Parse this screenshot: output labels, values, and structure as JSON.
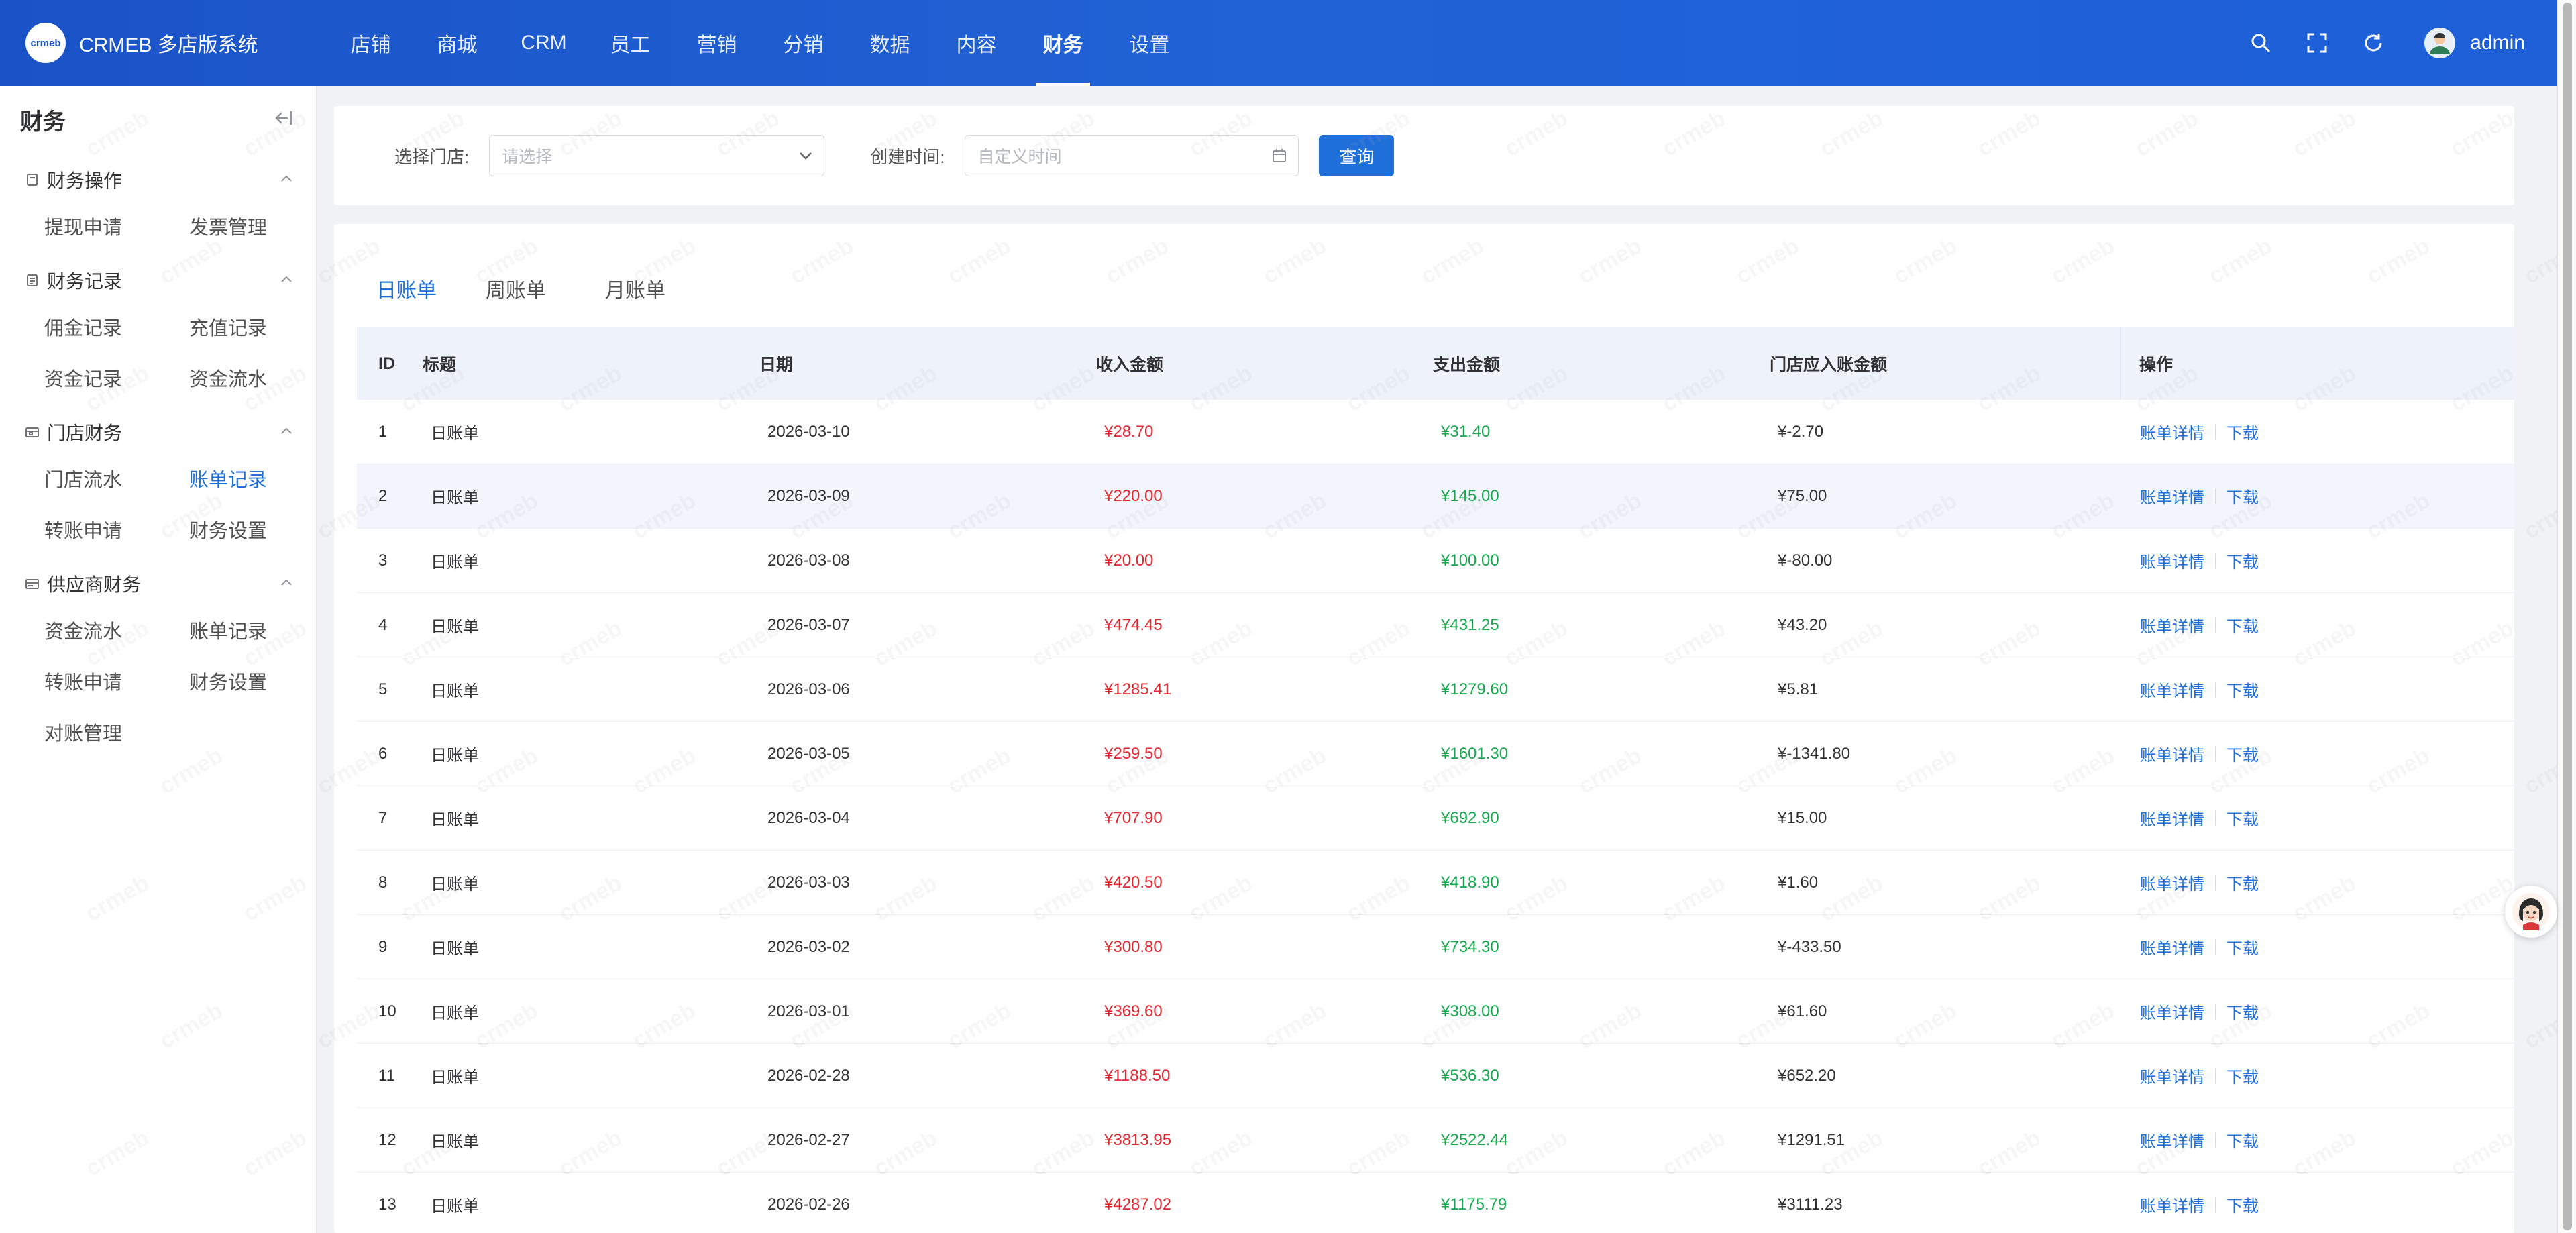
{
  "app": {
    "logo_mark": "crmeb",
    "title": "CRMEB 多店版系统",
    "user_name": "admin"
  },
  "nav": [
    {
      "label": "店铺",
      "active": false
    },
    {
      "label": "商城",
      "active": false
    },
    {
      "label": "CRM",
      "active": false
    },
    {
      "label": "员工",
      "active": false
    },
    {
      "label": "营销",
      "active": false
    },
    {
      "label": "分销",
      "active": false
    },
    {
      "label": "数据",
      "active": false
    },
    {
      "label": "内容",
      "active": false
    },
    {
      "label": "财务",
      "active": true
    },
    {
      "label": "设置",
      "active": false
    }
  ],
  "top_icons": [
    "search-icon",
    "fullscreen-icon",
    "refresh-icon"
  ],
  "sidebar": {
    "title": "财务",
    "groups": [
      {
        "label": "财务操作",
        "icon": "document-icon",
        "items": [
          "提现申请",
          "发票管理"
        ]
      },
      {
        "label": "财务记录",
        "icon": "list-icon",
        "items": [
          "佣金记录",
          "充值记录",
          "资金记录",
          "资金流水"
        ]
      },
      {
        "label": "门店财务",
        "icon": "store-icon",
        "items": [
          "门店流水",
          "账单记录",
          "转账申请",
          "财务设置"
        ]
      },
      {
        "label": "供应商财务",
        "icon": "supplier-icon",
        "items": [
          "资金流水",
          "账单记录",
          "转账申请",
          "财务设置",
          "对账管理"
        ]
      }
    ],
    "active_item": "门店财务/账单记录"
  },
  "filter": {
    "store_label": "选择门店:",
    "store_placeholder": "请选择",
    "time_label": "创建时间:",
    "time_placeholder": "自定义时间",
    "query_button": "查询"
  },
  "tabs": [
    {
      "label": "日账单",
      "active": true
    },
    {
      "label": "周账单",
      "active": false
    },
    {
      "label": "月账单",
      "active": false
    }
  ],
  "table": {
    "headers": {
      "id": "ID",
      "title": "标题",
      "date": "日期",
      "income": "收入金额",
      "expense": "支出金额",
      "store_net": "门店应入账金额",
      "ops": "操作"
    },
    "op_detail": "账单详情",
    "op_download": "下载",
    "rows": [
      {
        "id": "1",
        "title": "日账单",
        "date": "2026-03-10",
        "income": "¥28.70",
        "expense": "¥31.40",
        "net": "¥-2.70"
      },
      {
        "id": "2",
        "title": "日账单",
        "date": "2026-03-09",
        "income": "¥220.00",
        "expense": "¥145.00",
        "net": "¥75.00"
      },
      {
        "id": "3",
        "title": "日账单",
        "date": "2026-03-08",
        "income": "¥20.00",
        "expense": "¥100.00",
        "net": "¥-80.00"
      },
      {
        "id": "4",
        "title": "日账单",
        "date": "2026-03-07",
        "income": "¥474.45",
        "expense": "¥431.25",
        "net": "¥43.20"
      },
      {
        "id": "5",
        "title": "日账单",
        "date": "2026-03-06",
        "income": "¥1285.41",
        "expense": "¥1279.60",
        "net": "¥5.81"
      },
      {
        "id": "6",
        "title": "日账单",
        "date": "2026-03-05",
        "income": "¥259.50",
        "expense": "¥1601.30",
        "net": "¥-1341.80"
      },
      {
        "id": "7",
        "title": "日账单",
        "date": "2026-03-04",
        "income": "¥707.90",
        "expense": "¥692.90",
        "net": "¥15.00"
      },
      {
        "id": "8",
        "title": "日账单",
        "date": "2026-03-03",
        "income": "¥420.50",
        "expense": "¥418.90",
        "net": "¥1.60"
      },
      {
        "id": "9",
        "title": "日账单",
        "date": "2026-03-02",
        "income": "¥300.80",
        "expense": "¥734.30",
        "net": "¥-433.50"
      },
      {
        "id": "10",
        "title": "日账单",
        "date": "2026-03-01",
        "income": "¥369.60",
        "expense": "¥308.00",
        "net": "¥61.60"
      },
      {
        "id": "11",
        "title": "日账单",
        "date": "2026-02-28",
        "income": "¥1188.50",
        "expense": "¥536.30",
        "net": "¥652.20"
      },
      {
        "id": "12",
        "title": "日账单",
        "date": "2026-02-27",
        "income": "¥3813.95",
        "expense": "¥2522.44",
        "net": "¥1291.51"
      },
      {
        "id": "13",
        "title": "日账单",
        "date": "2026-02-26",
        "income": "¥4287.02",
        "expense": "¥1175.79",
        "net": "¥3111.23"
      }
    ],
    "highlighted_row": "2"
  },
  "watermark_text": "crmeb",
  "colors": {
    "brand": "#1e6fd9",
    "topbar": "#1a53c7",
    "income": "#e3262f",
    "expense": "#13a84b"
  }
}
